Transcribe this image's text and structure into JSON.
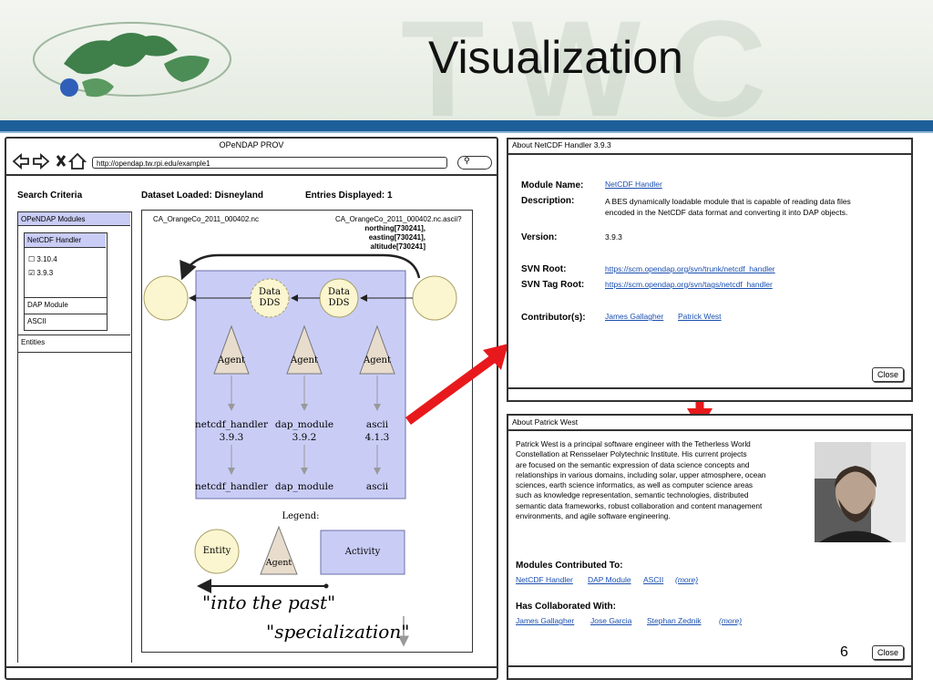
{
  "slide": {
    "title": "Visualization",
    "page_number": "6",
    "watermark": "TWC"
  },
  "browser": {
    "window_title": "OPeNDAP PROV",
    "url": "http://opendap.tw.rpi.edu/example1",
    "search_placeholder": "",
    "search_criteria_label": "Search Criteria",
    "dataset_loaded": "Dataset Loaded: Disneyland",
    "entries_displayed": "Entries Displayed: 1",
    "sidebar": {
      "modules_header": "OPeNDAP Modules",
      "netcdf_handler": "NetCDF Handler",
      "versions": [
        {
          "label": "3.10.4",
          "checked": false
        },
        {
          "label": "3.9.3",
          "checked": true
        }
      ],
      "dap_module": "DAP Module",
      "ascii": "ASCII",
      "entities": "Entities"
    },
    "graph": {
      "file_left": "CA_OrangeCo_2011_000402.nc",
      "file_right": "CA_OrangeCo_2011_000402.nc.ascii?",
      "file_right_params": [
        "northing[730241],",
        "easting[730241],",
        "altitude[730241]"
      ],
      "data_dds_1": [
        "Data",
        "DDS"
      ],
      "data_dds_2": [
        "Data",
        "DDS"
      ],
      "agent_label": "Agent",
      "activities": [
        {
          "name": "netcdf_handler",
          "version": "3.9.3"
        },
        {
          "name": "dap_module",
          "version": "3.9.2"
        },
        {
          "name": "ascii",
          "version": "4.1.3"
        }
      ],
      "lower_labels": [
        "netcdf_handler",
        "dap_module",
        "ascii"
      ],
      "legend_title": "Legend:",
      "legend_entity": "Entity",
      "legend_agent": "Agent",
      "legend_activity": "Activity",
      "into_the_past": "\"into the past\"",
      "specialization": "\"specialization\""
    }
  },
  "about_handler": {
    "title": "About NetCDF Handler 3.9.3",
    "module_name_label": "Module Name:",
    "module_name": "NetCDF Handler",
    "description_label": "Description:",
    "description_line1": "A BES dynamically loadable module that is capable of reading data files",
    "description_line2": "encoded in the NetCDF data format and converting it into DAP objects.",
    "version_label": "Version:",
    "version": "3.9.3",
    "svn_root_label": "SVN Root:",
    "svn_root": "https://scm.opendap.org/svn/trunk/netcdf_handler",
    "svn_tag_root_label": "SVN Tag Root:",
    "svn_tag_root": "https://scm.opendap.org/svn/tags/netcdf_handler",
    "contributors_label": "Contributor(s):",
    "contributors": [
      "James Gallagher",
      "Patrick West"
    ],
    "close": "Close"
  },
  "about_person": {
    "title": "About Patrick West",
    "bio_lines": [
      "Patrick West is a principal software engineer with the Tetherless World",
      "Constellation at Rensselaer Polytechnic Institute. His current projects",
      "are focused on the semantic expression of data science concepts and",
      "relationships in various domains, including solar, upper atmosphere, ocean",
      "sciences, earth science informatics, as well as computer science areas",
      "such as knowledge representation, semantic technologies, distributed",
      "semantic data frameworks, robust collaboration and content management",
      "environments, and agile software engineering."
    ],
    "modules_heading": "Modules Contributed To:",
    "modules": [
      "NetCDF Handler",
      "DAP Module",
      "ASCII"
    ],
    "modules_more": "(more)",
    "collab_heading": "Has Collaborated With:",
    "collaborators": [
      "James Gallagher",
      "Jose Garcia",
      "Stephan Zednik"
    ],
    "collab_more": "(more)",
    "close": "Close"
  },
  "colors": {
    "header_bar": "#1d5f99",
    "activity_fill": "#c9cdf6",
    "entity_fill": "#fbf6cf",
    "agent_fill": "#e8dccd",
    "arrow_red": "#e8191c",
    "link": "#1a4fb0"
  }
}
